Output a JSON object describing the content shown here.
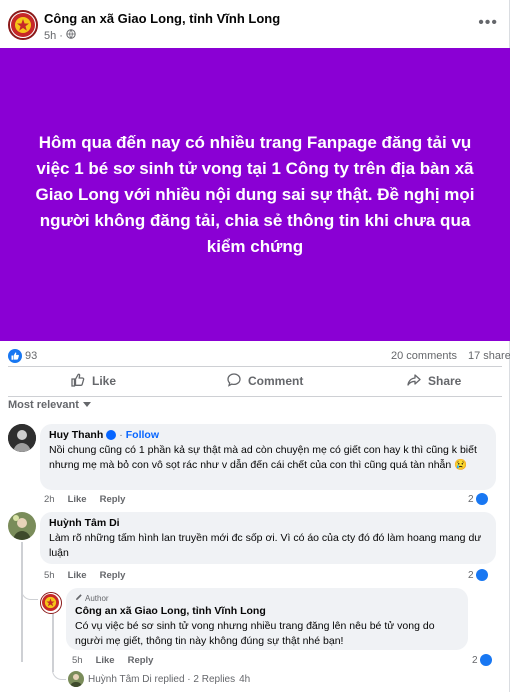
{
  "post": {
    "page_name": "Công an xã Giao Long, tỉnh Vĩnh Long",
    "time": "5h",
    "privacy_icon": "globe-icon",
    "banner_color": "#8a00d4",
    "banner_text": "Hôm qua đến nay có nhiều trang Fanpage đăng tải vụ việc 1 bé sơ sinh tử vong tại 1 Công ty trên địa bàn xã Giao Long với nhiều nội dung sai sự thật. Đề nghị mọi người không đăng tải, chia sẻ thông tin khi chưa qua kiểm chứng"
  },
  "stats": {
    "likes": "93",
    "comments": "20 comments",
    "shares": "17 share"
  },
  "actions": {
    "like": "Like",
    "comment": "Comment",
    "share": "Share"
  },
  "sort_label": "Most relevant",
  "comments": [
    {
      "name": "Huy Thanh",
      "follow": "Follow",
      "text": "Nồi chung cũng có 1 phần kả sự thật mà ad còn chuyện mẹ có giết con hay k thì cũng k biết nhưng mẹ mà bỏ con vô sọt rác như v dẫn đến cái chết của con thì cũng quá tàn nhẫn 😢",
      "time": "2h",
      "like": "Like",
      "reply": "Reply",
      "reactions": "2"
    },
    {
      "name": "Huỳnh Tâm Di",
      "text": "Làm rõ những tấm hình lan truyền mới đc sốp ơi. Vì có áo của cty đó đó làm hoang mang dư luận",
      "time": "5h",
      "like": "Like",
      "reply": "Reply",
      "reactions": "2"
    }
  ],
  "reply": {
    "badge": "Author",
    "name": "Công an xã Giao Long, tỉnh Vĩnh Long",
    "text": "Có vụ việc bé sơ sinh tử vong nhưng nhiều trang đăng lên nêu bé tử vong do người mẹ giết, thông tin này không đúng sự thật nhé bạn!",
    "time": "5h",
    "like": "Like",
    "reply": "Reply",
    "reactions": "2"
  },
  "replied_row": {
    "text": "Huỳnh Tâm Di replied · 2 Replies",
    "time": "4h"
  },
  "colors": {
    "accent": "#1877f2",
    "follow": "#0866ff",
    "muted": "#65676b"
  }
}
